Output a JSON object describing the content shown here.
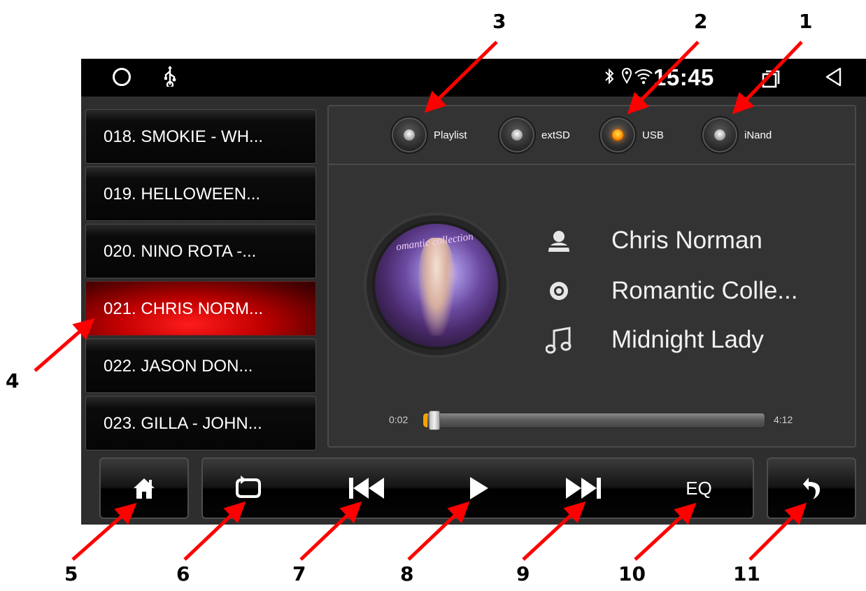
{
  "status_bar": {
    "time": "15:45",
    "icons": [
      "home-circle-icon",
      "usb-icon",
      "bluetooth-icon",
      "location-icon",
      "wifi-icon",
      "recent-apps-icon",
      "nav-back-icon"
    ]
  },
  "playlist": {
    "tracks": [
      {
        "label": "018. SMOKIE - WH...",
        "active": false
      },
      {
        "label": "019. HELLOWEEN...",
        "active": false
      },
      {
        "label": "020. NINO ROTA -...",
        "active": false
      },
      {
        "label": "021. CHRIS NORM...",
        "active": true
      },
      {
        "label": "022. JASON DON...",
        "active": false
      },
      {
        "label": "023. GILLA - JOHN...",
        "active": false
      }
    ]
  },
  "sources": [
    {
      "label": "Playlist",
      "selected": false
    },
    {
      "label": "extSD",
      "selected": false
    },
    {
      "label": "USB",
      "selected": true
    },
    {
      "label": "iNand",
      "selected": false
    }
  ],
  "now_playing": {
    "album_art_text": "omantic collection",
    "artist": "Chris Norman",
    "album": "Romantic Colle...",
    "title": "Midnight Lady",
    "elapsed": "0:02",
    "total": "4:12",
    "progress_fraction": 0.008
  },
  "controls": {
    "home_icon": "home-icon",
    "repeat_icon": "repeat-icon",
    "prev_icon": "previous-track-icon",
    "play_icon": "play-icon",
    "next_icon": "next-track-icon",
    "eq_label": "EQ",
    "back_icon": "back-arrow-icon"
  },
  "annotations": [
    "1",
    "2",
    "3",
    "4",
    "5",
    "6",
    "7",
    "8",
    "9",
    "10",
    "11"
  ],
  "colors": {
    "active_track": "#d40000",
    "accent_progress": "#f2a300",
    "selected_source": "#ff8a00",
    "arrow": "#ff0000"
  }
}
